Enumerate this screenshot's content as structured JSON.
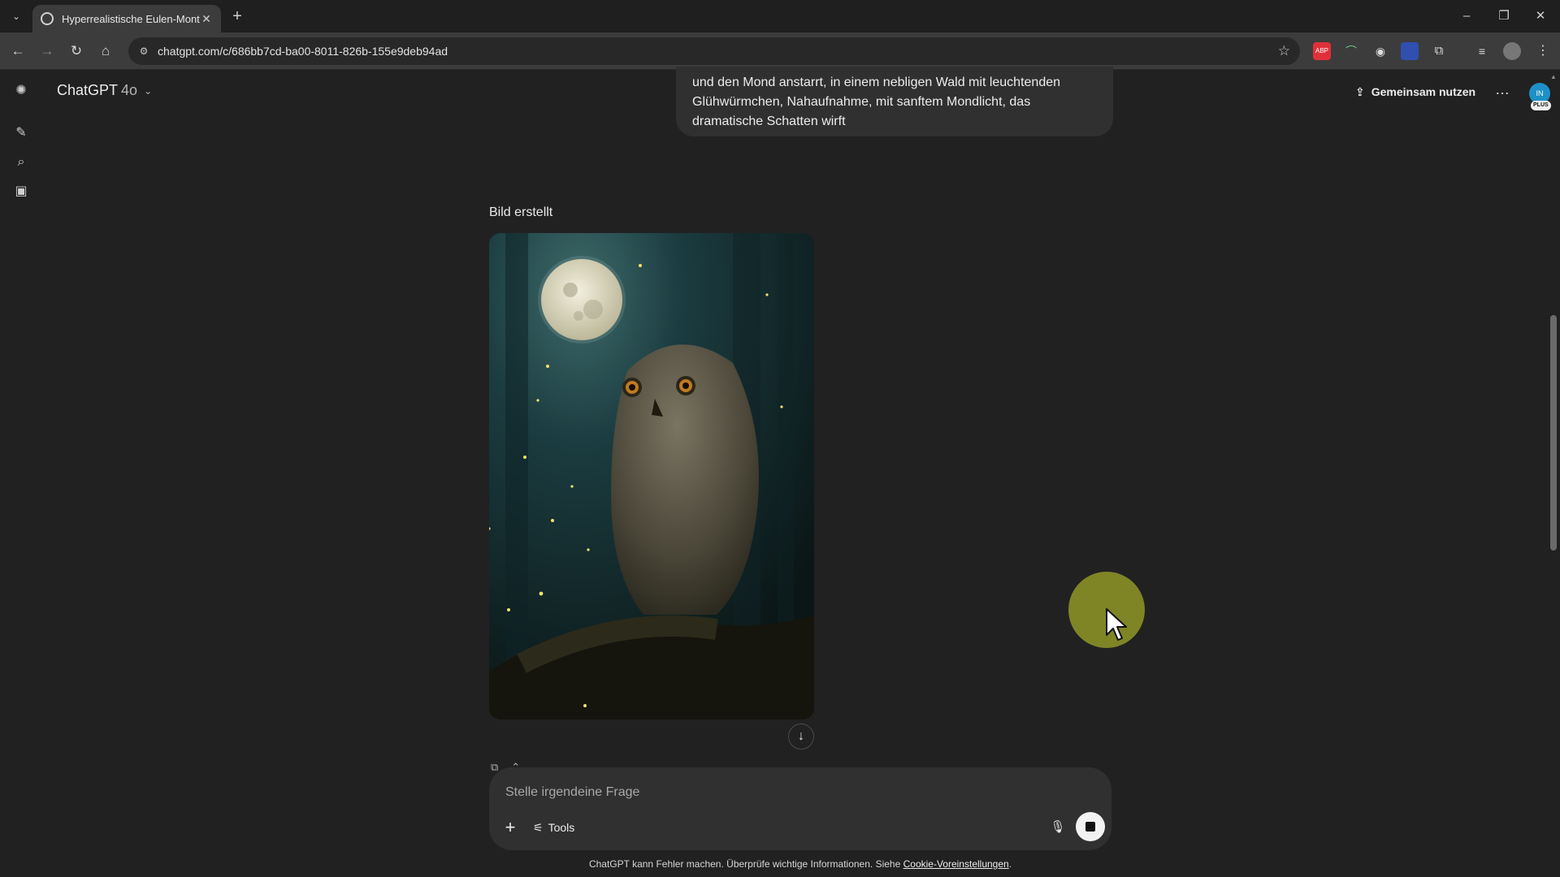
{
  "browser": {
    "tab_title": "Hyperrealistische Eulen-Montage",
    "url": "chatgpt.com/c/686bb7cd-ba00-8011-826b-155e9deb94ad",
    "extensions": [
      "ABP",
      "",
      "",
      "",
      ""
    ]
  },
  "header": {
    "model_name": "ChatGPT",
    "model_version": "4o",
    "share_label": "Gemeinsam nutzen",
    "avatar_initials": "IN",
    "plan_badge": "PLUS"
  },
  "conversation": {
    "user_message": "und den Mond anstarrt, in einem nebligen Wald mit leuchtenden Glühwürmchen, Nahaufnahme, mit sanftem Mondlicht, das dramatische Schatten wirft",
    "image_label": "Bild erstellt"
  },
  "composer": {
    "placeholder": "Stelle irgendeine Frage",
    "tools_label": "Tools"
  },
  "footer": {
    "disclaimer": "ChatGPT kann Fehler machen. Überprüfe wichtige Informationen. Siehe ",
    "cookie_link": "Cookie-Voreinstellungen",
    "suffix": "."
  },
  "colors": {
    "background": "#212121",
    "bubble": "#303030",
    "avatar": "#1e90c8",
    "cursor_highlight": "#bec828"
  }
}
